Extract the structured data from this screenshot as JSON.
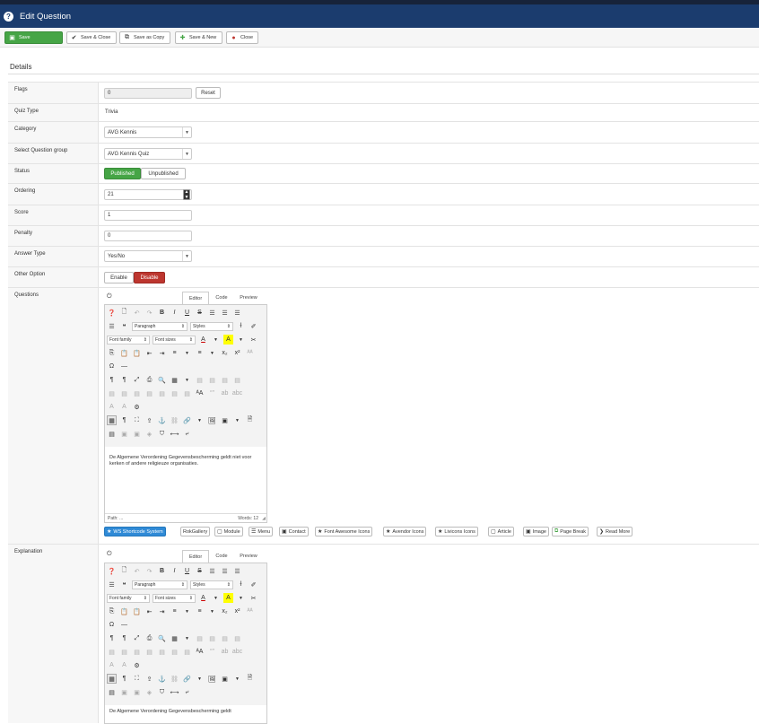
{
  "header": {
    "title": "Edit Question"
  },
  "toolbar": {
    "save": "Save",
    "save_close": "Save & Close",
    "save_copy": "Save as Copy",
    "save_new": "Save & New",
    "close": "Close"
  },
  "details": {
    "title": "Details"
  },
  "fields": {
    "flags": {
      "label": "Flags",
      "value": "0",
      "reset": "Reset"
    },
    "quiz_type": {
      "label": "Quiz Type",
      "value": "Trivia"
    },
    "category": {
      "label": "Category",
      "value": "AVG Kennis"
    },
    "question_group": {
      "label": "Select Question group",
      "value": "AVG Kennis Quiz"
    },
    "status": {
      "label": "Status",
      "published": "Published",
      "unpublished": "Unpublished"
    },
    "ordering": {
      "label": "Ordering",
      "value": "21"
    },
    "score": {
      "label": "Score",
      "value": "1"
    },
    "penalty": {
      "label": "Penalty",
      "value": "0"
    },
    "answer_type": {
      "label": "Answer Type",
      "value": "Yes/No"
    },
    "other_option": {
      "label": "Other Option",
      "enable": "Enable",
      "disable": "Disable"
    },
    "questions": {
      "label": "Questions"
    },
    "explanation": {
      "label": "Explanation"
    }
  },
  "editor": {
    "tabs": [
      "Editor",
      "Code",
      "Preview"
    ],
    "paragraph": "Paragraph",
    "styles": "Styles",
    "font_family": "Font family",
    "font_sizes": "Font sizes",
    "question_text": "De Algemene Verordening Gegevensbescherming geldt niet voor kerken of andere religieuze organisaties.",
    "explanation_text": "De Algemene Verordening Gegevensbescherming geldt",
    "path": "Path: ...",
    "words": "Words: 12"
  },
  "extra_buttons": [
    "WS Shortcode System",
    "RokGallery",
    "Module",
    "Menu",
    "Contact",
    "Font Awesome Icons",
    "Avendor Icons",
    "Livicons Icons",
    "Article",
    "Image",
    "Page Break",
    "Read More"
  ],
  "colors": {
    "header": "#1b3c6e",
    "save": "#46a546",
    "published": "#46a546",
    "disable": "#bd362f",
    "ws_button": "#2f8ad6"
  },
  "icons": [
    "question-circle-icon",
    "save-icon",
    "check-icon",
    "copy-icon",
    "plus-icon",
    "close-icon",
    "power-icon"
  ]
}
